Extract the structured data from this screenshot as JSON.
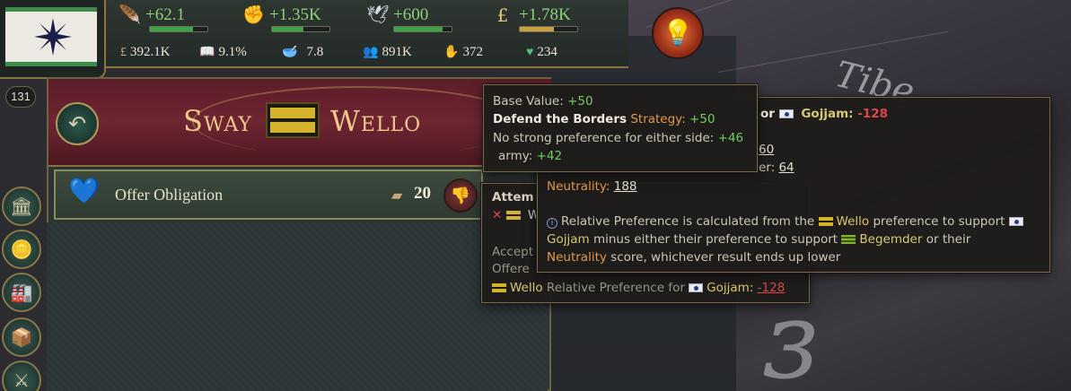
{
  "topbar": {
    "resources": [
      {
        "icon": "feather-icon",
        "glyph": "🪶",
        "value": "+62.1",
        "fill": 0.75
      },
      {
        "icon": "influence-icon",
        "glyph": "✊",
        "value": "+1.35K",
        "fill": 0.55
      },
      {
        "icon": "dove-icon",
        "glyph": "🕊",
        "value": "+600",
        "fill": 0.85
      },
      {
        "icon": "pound-icon",
        "glyph": "£",
        "value": "+1.78K",
        "fill": 0.6
      }
    ],
    "stats": [
      {
        "icon": "treasury-icon",
        "glyph": "£",
        "value": "392.1K"
      },
      {
        "icon": "literacy-icon",
        "glyph": "📖",
        "value": "9.1%"
      },
      {
        "icon": "sol-icon",
        "glyph": "🥣",
        "value": "7.8"
      },
      {
        "icon": "population-icon",
        "glyph": "👥",
        "value": "891K"
      },
      {
        "icon": "army-icon",
        "glyph": "✋",
        "value": "372"
      },
      {
        "icon": "approval-icon",
        "glyph": "♥",
        "value": "234"
      }
    ],
    "bar_colors": {
      "resource": "#3ca447",
      "pound": "#c8a040"
    }
  },
  "badge": "131",
  "panel": {
    "title_left": "Sway",
    "title_right": "Wello",
    "action": {
      "label": "Offer Obligation",
      "cost": "20"
    }
  },
  "map": {
    "label": "Tibe",
    "glyph_big": "ɜ"
  },
  "tooltip_front": {
    "base_value_label": "Base Value:",
    "base_value": "+50",
    "strategy_name": "Defend the Borders",
    "strategy_word": "Strategy:",
    "strategy_value": "+50",
    "no_pref_label": "No strong preference for either side:",
    "no_pref_value": "+46",
    "army_label": "army:",
    "army_value": "+42"
  },
  "tooltip_mid": {
    "header_prefix": "or",
    "header_country": "Gojjam:",
    "header_value": "-128",
    "row1_value": "60",
    "row2_suffix": "er:",
    "row2_value": "64",
    "neutrality_label": "Neutrality:",
    "neutrality_value": "188",
    "note_1": "Relative Preference is calculated from the",
    "note_wello": "Wello",
    "note_2": "preference to support",
    "note_gojjam": "Gojjam",
    "note_3": "minus either their preference to support",
    "note_begemder": "Begemder",
    "note_4": "or their",
    "note_neutrality": "Neutrality",
    "note_5": "score, whichever result ends up lower"
  },
  "tooltip_back": {
    "title_partial": "Attem",
    "wello_partial": "W",
    "accept_partial": "Accept",
    "offer_partial": "Offere",
    "footer_wello": "Wello",
    "footer_text": "Relative Preference for",
    "footer_country": "Gojjam:",
    "footer_value": "-128"
  },
  "rail": [
    {
      "name": "government-button",
      "glyph": "🏛"
    },
    {
      "name": "budget-button",
      "glyph": "🪙"
    },
    {
      "name": "industry-button",
      "glyph": "🏭"
    },
    {
      "name": "trade-button",
      "glyph": "📦"
    },
    {
      "name": "military-button",
      "glyph": "⚔"
    }
  ]
}
